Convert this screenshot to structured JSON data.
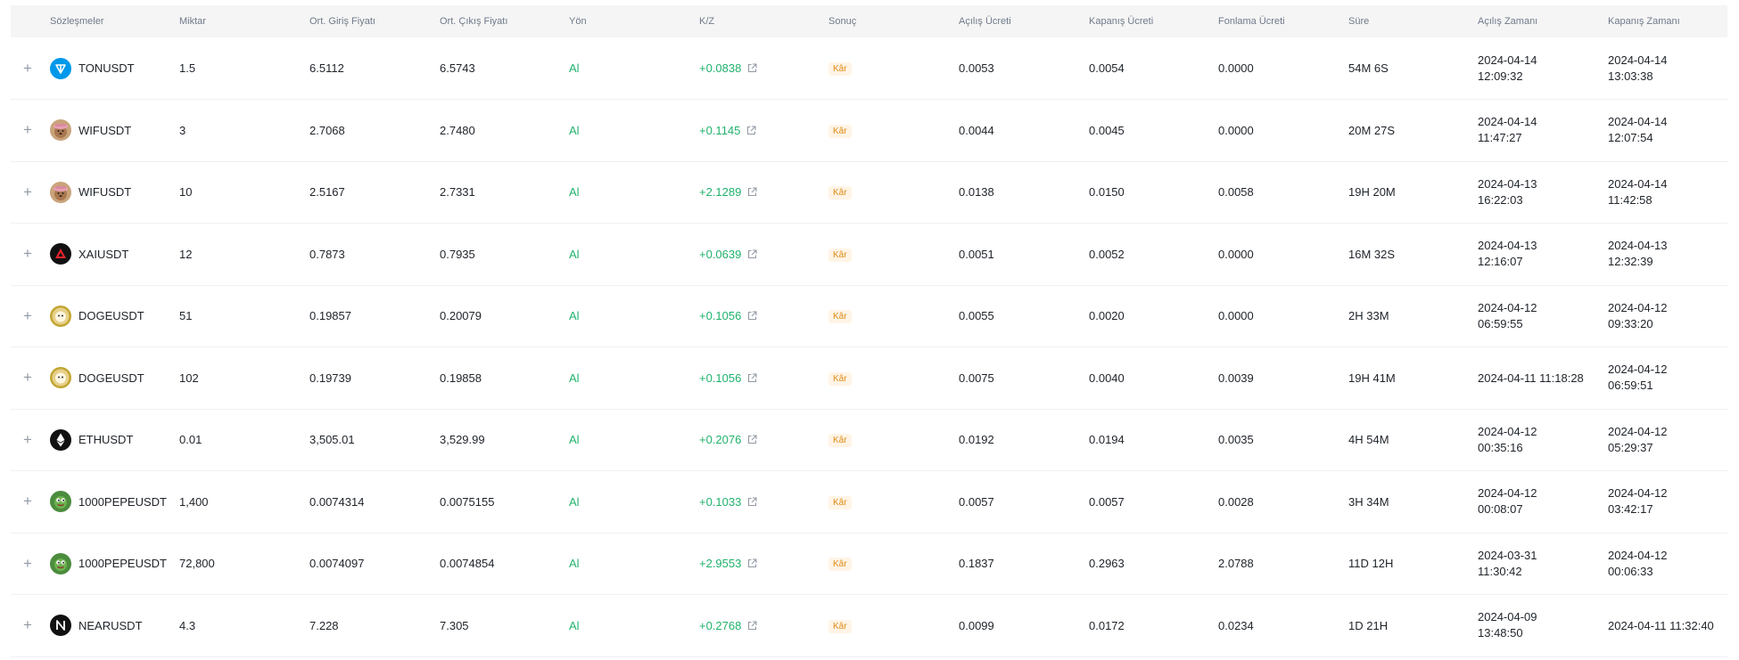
{
  "header": {
    "expand": "",
    "contract": "Sözleşmeler",
    "amount": "Miktar",
    "avg_entry": "Ort. Giriş Fiyatı",
    "avg_exit": "Ort. Çıkış Fiyatı",
    "direction": "Yön",
    "pnl": "K/Z",
    "result": "Sonuç",
    "open_fee": "Açılış Ücreti",
    "close_fee": "Kapanış Ücreti",
    "funding_fee": "Fonlama Ücreti",
    "duration": "Süre",
    "open_time": "Açılış Zamanı",
    "close_time": "Kapanış Zamanı"
  },
  "rows": [
    {
      "expand": "+",
      "coin_icon": "ton-icon",
      "symbol": "TONUSDT",
      "amount": "1.5",
      "entry": "6.5112",
      "exit": "6.5743",
      "side": "Al",
      "pnl": "+0.0838",
      "result": "Kâr",
      "open_fee": "0.0053",
      "close_fee": "0.0054",
      "funding_fee": "0.0000",
      "duration": "54M 6S",
      "open_date": "2024-04-14",
      "open_clock": "12:09:32",
      "close_date": "2024-04-14",
      "close_clock": "13:03:38"
    },
    {
      "expand": "+",
      "coin_icon": "wif-icon",
      "symbol": "WIFUSDT",
      "amount": "3",
      "entry": "2.7068",
      "exit": "2.7480",
      "side": "Al",
      "pnl": "+0.1145",
      "result": "Kâr",
      "open_fee": "0.0044",
      "close_fee": "0.0045",
      "funding_fee": "0.0000",
      "duration": "20M 27S",
      "open_date": "2024-04-14",
      "open_clock": "11:47:27",
      "close_date": "2024-04-14",
      "close_clock": "12:07:54"
    },
    {
      "expand": "+",
      "coin_icon": "wif-icon",
      "symbol": "WIFUSDT",
      "amount": "10",
      "entry": "2.5167",
      "exit": "2.7331",
      "side": "Al",
      "pnl": "+2.1289",
      "result": "Kâr",
      "open_fee": "0.0138",
      "close_fee": "0.0150",
      "funding_fee": "0.0058",
      "duration": "19H 20M",
      "open_date": "2024-04-13",
      "open_clock": "16:22:03",
      "close_date": "2024-04-14",
      "close_clock": "11:42:58"
    },
    {
      "expand": "+",
      "coin_icon": "xai-icon",
      "symbol": "XAIUSDT",
      "amount": "12",
      "entry": "0.7873",
      "exit": "0.7935",
      "side": "Al",
      "pnl": "+0.0639",
      "result": "Kâr",
      "open_fee": "0.0051",
      "close_fee": "0.0052",
      "funding_fee": "0.0000",
      "duration": "16M 32S",
      "open_date": "2024-04-13",
      "open_clock": "12:16:07",
      "close_date": "2024-04-13",
      "close_clock": "12:32:39"
    },
    {
      "expand": "+",
      "coin_icon": "doge-icon",
      "symbol": "DOGEUSDT",
      "amount": "51",
      "entry": "0.19857",
      "exit": "0.20079",
      "side": "Al",
      "pnl": "+0.1056",
      "result": "Kâr",
      "open_fee": "0.0055",
      "close_fee": "0.0020",
      "funding_fee": "0.0000",
      "duration": "2H 33M",
      "open_date": "2024-04-12",
      "open_clock": "06:59:55",
      "close_date": "2024-04-12",
      "close_clock": "09:33:20"
    },
    {
      "expand": "+",
      "coin_icon": "doge-icon",
      "symbol": "DOGEUSDT",
      "amount": "102",
      "entry": "0.19739",
      "exit": "0.19858",
      "side": "Al",
      "pnl": "+0.1056",
      "result": "Kâr",
      "open_fee": "0.0075",
      "close_fee": "0.0040",
      "funding_fee": "0.0039",
      "duration": "19H 41M",
      "open_date": "2024-04-11 11:18:28",
      "open_clock": "",
      "close_date": "2024-04-12",
      "close_clock": "06:59:51"
    },
    {
      "expand": "+",
      "coin_icon": "eth-icon",
      "symbol": "ETHUSDT",
      "amount": "0.01",
      "entry": "3,505.01",
      "exit": "3,529.99",
      "side": "Al",
      "pnl": "+0.2076",
      "result": "Kâr",
      "open_fee": "0.0192",
      "close_fee": "0.0194",
      "funding_fee": "0.0035",
      "duration": "4H 54M",
      "open_date": "2024-04-12",
      "open_clock": "00:35:16",
      "close_date": "2024-04-12",
      "close_clock": "05:29:37"
    },
    {
      "expand": "+",
      "coin_icon": "pepe-icon",
      "symbol": "1000PEPEUSDT",
      "amount": "1,400",
      "entry": "0.0074314",
      "exit": "0.0075155",
      "side": "Al",
      "pnl": "+0.1033",
      "result": "Kâr",
      "open_fee": "0.0057",
      "close_fee": "0.0057",
      "funding_fee": "0.0028",
      "duration": "3H 34M",
      "open_date": "2024-04-12",
      "open_clock": "00:08:07",
      "close_date": "2024-04-12",
      "close_clock": "03:42:17"
    },
    {
      "expand": "+",
      "coin_icon": "pepe-icon",
      "symbol": "1000PEPEUSDT",
      "amount": "72,800",
      "entry": "0.0074097",
      "exit": "0.0074854",
      "side": "Al",
      "pnl": "+2.9553",
      "result": "Kâr",
      "open_fee": "0.1837",
      "close_fee": "0.2963",
      "funding_fee": "2.0788",
      "duration": "11D 12H",
      "open_date": "2024-03-31",
      "open_clock": "11:30:42",
      "close_date": "2024-04-12",
      "close_clock": "00:06:33"
    },
    {
      "expand": "+",
      "coin_icon": "near-icon",
      "symbol": "NEARUSDT",
      "amount": "4.3",
      "entry": "7.228",
      "exit": "7.305",
      "side": "Al",
      "pnl": "+0.2768",
      "result": "Kâr",
      "open_fee": "0.0099",
      "close_fee": "0.0172",
      "funding_fee": "0.0234",
      "duration": "1D 21H",
      "open_date": "2024-04-09",
      "open_clock": "13:48:50",
      "close_date": "2024-04-11 11:32:40",
      "close_clock": ""
    }
  ],
  "colors": {
    "profit": "#20b26c",
    "badge_text": "#e08a13",
    "badge_bg": "#fff4e6",
    "header_bg": "#f5f5f5"
  }
}
